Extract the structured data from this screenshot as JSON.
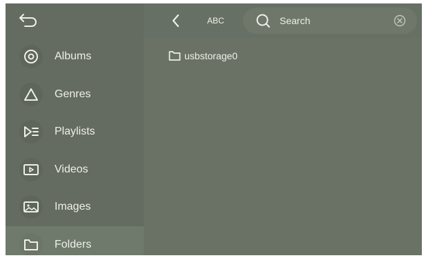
{
  "header": {
    "back_icon": "back-arrow-icon",
    "sort_label": "ABC",
    "search": {
      "placeholder": "Search",
      "icon": "search-icon",
      "clear_icon": "clear-icon"
    }
  },
  "sidebar": {
    "items": [
      {
        "label": "Albums",
        "icon": "album-disc-icon",
        "active": false
      },
      {
        "label": "Genres",
        "icon": "triangle-icon",
        "active": false
      },
      {
        "label": "Playlists",
        "icon": "playlist-icon",
        "active": false
      },
      {
        "label": "Videos",
        "icon": "video-icon",
        "active": false
      },
      {
        "label": "Images",
        "icon": "image-icon",
        "active": false
      },
      {
        "label": "Folders",
        "icon": "folder-icon",
        "active": true
      }
    ]
  },
  "content": {
    "folders": [
      {
        "label": "usbstorage0",
        "icon": "folder-icon"
      }
    ]
  },
  "colors": {
    "background": "#6a7265",
    "sidebar": "#646b60",
    "active_item": "#707a6c",
    "text": "#eef0ea"
  }
}
